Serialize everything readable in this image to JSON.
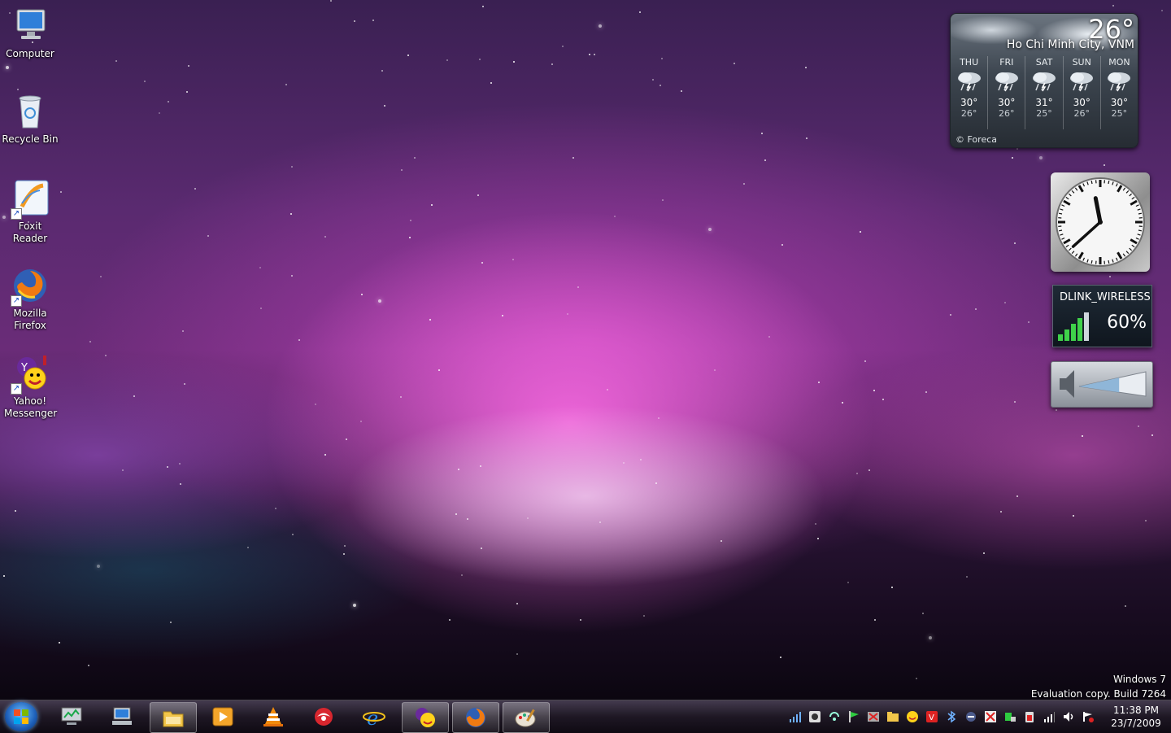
{
  "desktop": {
    "icons": [
      {
        "label": "Computer"
      },
      {
        "label": "Recycle Bin"
      },
      {
        "label": "Foxit Reader"
      },
      {
        "label": "Mozilla Firefox"
      },
      {
        "label": "Yahoo! Messenger"
      }
    ]
  },
  "weather": {
    "temp": "26°",
    "city": "Ho Chi Minh City, VNM",
    "forecast": [
      {
        "day": "THU",
        "hi": "30°",
        "lo": "26°"
      },
      {
        "day": "FRI",
        "hi": "30°",
        "lo": "26°"
      },
      {
        "day": "SAT",
        "hi": "31°",
        "lo": "25°"
      },
      {
        "day": "SUN",
        "hi": "30°",
        "lo": "26°"
      },
      {
        "day": "MON",
        "hi": "30°",
        "lo": "25°"
      }
    ],
    "credit": "© Foreca"
  },
  "clock_gadget": {
    "hour": 11,
    "minute": 38
  },
  "wireless": {
    "ssid": "DLINK_WIRELESS",
    "signal": "60%"
  },
  "volume": {
    "level": 0.6
  },
  "watermark": {
    "line1": "Windows 7",
    "line2": "Evaluation copy. Build 7264"
  },
  "taskbar": {
    "buttons": [
      {
        "icon": "system-monitor-icon",
        "active": false
      },
      {
        "icon": "network-computer-icon",
        "active": false
      },
      {
        "icon": "windows-explorer-icon",
        "active": true
      },
      {
        "icon": "media-player-icon",
        "active": false
      },
      {
        "icon": "vlc-icon",
        "active": false
      },
      {
        "icon": "nero-icon",
        "active": false
      },
      {
        "icon": "internet-explorer-icon",
        "active": false
      },
      {
        "icon": "yahoo-messenger-icon",
        "active": true
      },
      {
        "icon": "firefox-icon",
        "active": true
      },
      {
        "icon": "paint-icon",
        "active": true
      }
    ],
    "time": "11:38 PM",
    "date": "23/7/2009"
  },
  "colors": {
    "accent": "#d65ad8",
    "taskbar": "#1e1824"
  }
}
